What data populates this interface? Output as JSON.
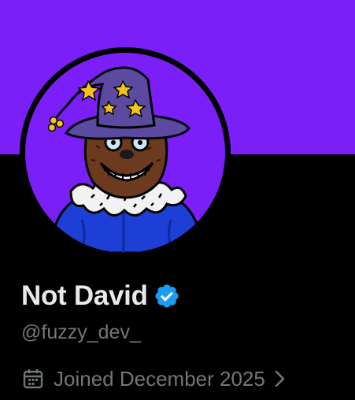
{
  "profile": {
    "display_name": "Not David",
    "handle": "@fuzzy_dev_",
    "joined": "Joined December 2025"
  },
  "icons": {
    "verified": "verified-badge-icon",
    "calendar": "calendar-icon",
    "chevron": "chevron-right-icon"
  },
  "colors": {
    "banner": "#7b1ff9",
    "background": "#000000",
    "name_text": "#e7e9ea",
    "secondary_text": "#71767b",
    "verified_badge": "#1d9bf0"
  }
}
